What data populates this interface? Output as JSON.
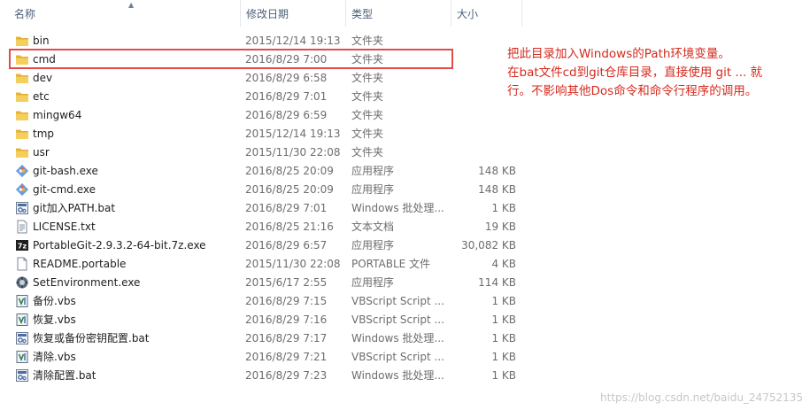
{
  "columns": {
    "name": "名称",
    "date": "修改日期",
    "type": "类型",
    "size": "大小"
  },
  "files": [
    {
      "icon": "folder-icon",
      "name": "bin",
      "date": "2015/12/14 19:13",
      "type": "文件夹",
      "size": ""
    },
    {
      "icon": "folder-icon",
      "name": "cmd",
      "date": "2016/8/29 7:00",
      "type": "文件夹",
      "size": ""
    },
    {
      "icon": "folder-icon",
      "name": "dev",
      "date": "2016/8/29 6:58",
      "type": "文件夹",
      "size": ""
    },
    {
      "icon": "folder-icon",
      "name": "etc",
      "date": "2016/8/29 7:01",
      "type": "文件夹",
      "size": ""
    },
    {
      "icon": "folder-icon",
      "name": "mingw64",
      "date": "2016/8/29 6:59",
      "type": "文件夹",
      "size": ""
    },
    {
      "icon": "folder-icon",
      "name": "tmp",
      "date": "2015/12/14 19:13",
      "type": "文件夹",
      "size": ""
    },
    {
      "icon": "folder-icon",
      "name": "usr",
      "date": "2015/11/30 22:08",
      "type": "文件夹",
      "size": ""
    },
    {
      "icon": "git-exe-icon",
      "name": "git-bash.exe",
      "date": "2016/8/25 20:09",
      "type": "应用程序",
      "size": "148 KB"
    },
    {
      "icon": "git-exe-icon",
      "name": "git-cmd.exe",
      "date": "2016/8/25 20:09",
      "type": "应用程序",
      "size": "148 KB"
    },
    {
      "icon": "batch-file-icon",
      "name": "git加入PATH.bat",
      "date": "2016/8/29 7:01",
      "type": "Windows 批处理...",
      "size": "1 KB"
    },
    {
      "icon": "text-file-icon",
      "name": "LICENSE.txt",
      "date": "2016/8/25 21:16",
      "type": "文本文档",
      "size": "19 KB"
    },
    {
      "icon": "7z-archive-icon",
      "name": "PortableGit-2.9.3.2-64-bit.7z.exe",
      "date": "2016/8/29 6:57",
      "type": "应用程序",
      "size": "30,082 KB"
    },
    {
      "icon": "blank-file-icon",
      "name": "README.portable",
      "date": "2015/11/30 22:08",
      "type": "PORTABLE 文件",
      "size": "4 KB"
    },
    {
      "icon": "setup-exe-icon",
      "name": "SetEnvironment.exe",
      "date": "2015/6/17 2:55",
      "type": "应用程序",
      "size": "114 KB"
    },
    {
      "icon": "vbscript-icon",
      "name": "备份.vbs",
      "date": "2016/8/29 7:15",
      "type": "VBScript Script ...",
      "size": "1 KB"
    },
    {
      "icon": "vbscript-icon",
      "name": "恢复.vbs",
      "date": "2016/8/29 7:16",
      "type": "VBScript Script ...",
      "size": "1 KB"
    },
    {
      "icon": "batch-file-icon",
      "name": "恢复或备份密钥配置.bat",
      "date": "2016/8/29 7:17",
      "type": "Windows 批处理...",
      "size": "1 KB"
    },
    {
      "icon": "vbscript-icon",
      "name": "清除.vbs",
      "date": "2016/8/29 7:21",
      "type": "VBScript Script ...",
      "size": "1 KB"
    },
    {
      "icon": "batch-file-icon",
      "name": "清除配置.bat",
      "date": "2016/8/29 7:23",
      "type": "Windows 批处理...",
      "size": "1 KB"
    }
  ],
  "annotation": {
    "line1": "把此目录加入Windows的Path环境变量。",
    "line2": "在bat文件cd到git仓库目录，直接使用 git ... 就",
    "line3": "行。不影响其他Dos命令和命令行程序的调用。"
  },
  "watermark": "https://blog.csdn.net/baidu_24752135",
  "colors": {
    "annotation": "#d52a1e",
    "highlight_border": "#e34b4b",
    "folder": "#e8b73a",
    "header_text": "#4c607a"
  }
}
